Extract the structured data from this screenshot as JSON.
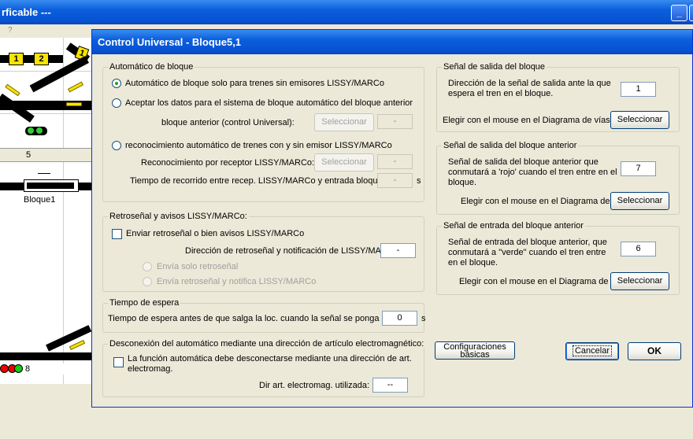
{
  "background_app": {
    "title_fragment": "rficable   ---",
    "menu_fragment": "?",
    "ruler_number": "5",
    "bloque_label": "Bloque1",
    "bottom_number": "8",
    "track_numbers": [
      "1",
      "2",
      "1"
    ]
  },
  "dialog": {
    "title": "Control Universal - Bloque5,1",
    "automatico": {
      "legend": "Automático de bloque",
      "option1": "Automático de bloque solo para trenes sin emisores LISSY/MARCo",
      "option2": "Aceptar los datos para el sistema de bloque automático del bloque anterior",
      "bloque_anterior_label": "bloque anterior (control Universal):",
      "bloque_anterior_button": "Seleccionar",
      "bloque_anterior_value": "-",
      "option3": "reconocimiento automático de trenes con y sin emisor LISSY/MARCo",
      "receptor_label": "Reconocimiento por receptor LISSY/MARCo:",
      "receptor_button": "Seleccionar",
      "receptor_value": "-",
      "tiempo_label": "Tiempo de recorrido entre recep. LISSY/MARCo y entrada bloque:",
      "tiempo_value": "-",
      "tiempo_unit": "s"
    },
    "retrosenal": {
      "legend": "Retroseñal y avisos LISSY/MARCo:",
      "checkbox_label": "Enviar retroseñal o bien avisos LISSY/MARCo",
      "direccion_label": "Dirección de retroseñal y notificación de LISSY/MARCo:",
      "direccion_value": "-",
      "radio1": "Envía solo retroseñal",
      "radio2": "Envía retroseñal y notifica LISSY/MARCo"
    },
    "espera": {
      "legend": "Tiempo de espera",
      "label": "Tiempo de espera antes de que salga la loc. cuando la señal se ponga",
      "value": "0",
      "unit": "s"
    },
    "desconexion": {
      "legend": "Desconexión del automático mediante una dirección de artículo electromagnético:",
      "checkbox_label_line1": "La función automática debe desconectarse mediante una dirección de art.",
      "checkbox_label_line2": "electromag.",
      "dir_label": "Dir art. electromag. utilizada:",
      "dir_value": "--"
    },
    "salida": {
      "legend": "Señal de salida del bloque",
      "desc_line1": "Dirección de la señal de salida ante la que",
      "desc_line2": "espera el tren en el bloque.",
      "value": "1",
      "mouse_label": "Elegir con el mouse en el Diagrama de vías:",
      "button": "Seleccionar"
    },
    "salida_anterior": {
      "legend": "Señal de salida del bloque anterior",
      "desc_line1": "Señal de salida del bloque anterior que",
      "desc_line2": "conmutará a 'rojo' cuando el tren entre en el",
      "desc_line3": "bloque.",
      "value": "7",
      "mouse_label": "Elegir con el mouse en el Diagrama de",
      "button": "Seleccionar"
    },
    "entrada_anterior": {
      "legend": "Señal de entrada del bloque anterior",
      "desc_line1": "Señal de entrada del bloque anterior, que",
      "desc_line2": "conmutará a \"verde\" cuando el tren entre",
      "desc_line3": "en el bloque.",
      "value": "6",
      "mouse_label": "Elegir con el mouse en el Diagrama de",
      "button": "Seleccionar"
    },
    "buttons": {
      "config_line1": "Configuraciones",
      "config_line2": "básicas",
      "cancel": "Cancelar",
      "ok": "OK"
    }
  }
}
